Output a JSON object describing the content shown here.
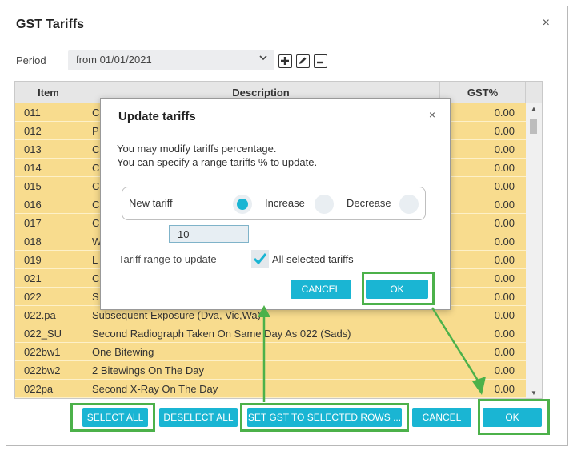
{
  "window": {
    "title": "GST Tariffs",
    "close_glyph": "×"
  },
  "period": {
    "label": "Period",
    "value": "from 01/01/2021",
    "icons": [
      "add-icon",
      "edit-icon",
      "remove-icon"
    ]
  },
  "grid": {
    "columns": {
      "item": "Item",
      "description": "Description",
      "gst": "GST%"
    },
    "rows": [
      {
        "item": "011",
        "desc": "C",
        "gst": "0.00"
      },
      {
        "item": "012",
        "desc": "P",
        "gst": "0.00"
      },
      {
        "item": "013",
        "desc": "C",
        "gst": "0.00"
      },
      {
        "item": "014",
        "desc": "C",
        "gst": "0.00"
      },
      {
        "item": "015",
        "desc": "C",
        "gst": "0.00"
      },
      {
        "item": "016",
        "desc": "C",
        "gst": "0.00"
      },
      {
        "item": "017",
        "desc": "C",
        "gst": "0.00"
      },
      {
        "item": "018",
        "desc": "W",
        "gst": "0.00"
      },
      {
        "item": "019",
        "desc": "L",
        "gst": "0.00"
      },
      {
        "item": "021",
        "desc": "C",
        "gst": "0.00"
      },
      {
        "item": "022",
        "desc": "S",
        "gst": "0.00"
      },
      {
        "item": "022.pa",
        "desc": "Subsequent Exposure (Dva, Vic,Wa)",
        "gst": "0.00"
      },
      {
        "item": "022_SU",
        "desc": "Second Radiograph Taken On Same Day As 022 (Sads)",
        "gst": "0.00"
      },
      {
        "item": "022bw1",
        "desc": "One Bitewing",
        "gst": "0.00"
      },
      {
        "item": "022bw2",
        "desc": "2 Bitewings On The Day",
        "gst": "0.00"
      },
      {
        "item": "022pa",
        "desc": "Second X-Ray On The Day",
        "gst": "0.00"
      }
    ]
  },
  "buttons": {
    "select_all": "SELECT ALL",
    "deselect_all": "DESELECT ALL",
    "set_gst": "SET GST TO SELECTED ROWS ...",
    "cancel": "CANCEL",
    "ok": "OK"
  },
  "dialog": {
    "title": "Update tariffs",
    "close_glyph": "×",
    "message_line1": "You may modify tariffs percentage.",
    "message_line2": "You can specify a range tariffs % to update.",
    "new_tariff_label": "New tariff",
    "increase_label": "Increase",
    "decrease_label": "Decrease",
    "selected_option": "New tariff",
    "tariff_value": "10",
    "range_label": "Tariff range to update",
    "all_selected_label": "All selected tariffs",
    "all_selected_checked": true,
    "cancel_label": "CANCEL",
    "ok_label": "OK"
  },
  "colors": {
    "accent": "#1ab5d3",
    "row_highlight": "#f8dc8e",
    "annotation": "#4cb14a"
  }
}
